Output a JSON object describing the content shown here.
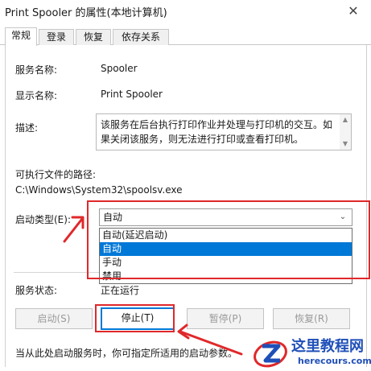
{
  "window": {
    "title": "Print Spooler 的属性(本地计算机)",
    "close_glyph": "✕"
  },
  "tabs": [
    {
      "label": "常规",
      "active": true
    },
    {
      "label": "登录",
      "active": false
    },
    {
      "label": "恢复",
      "active": false
    },
    {
      "label": "依存关系",
      "active": false
    }
  ],
  "general": {
    "service_name_label": "服务名称:",
    "service_name_value": "Spooler",
    "display_name_label": "显示名称:",
    "display_name_value": "Print Spooler",
    "description_label": "描述:",
    "description_text": "该服务在后台执行打印作业并处理与打印机的交互。如果关闭该服务，则无法进行打印或查看打印机。",
    "exec_path_label": "可执行文件的路径:",
    "exec_path_value": "C:\\Windows\\System32\\spoolsv.exe",
    "startup_type_label": "启动类型(E):",
    "startup_type_value": "自动",
    "startup_options": [
      {
        "label": "自动(延迟启动)",
        "selected": false
      },
      {
        "label": "自动",
        "selected": true
      },
      {
        "label": "手动",
        "selected": false
      },
      {
        "label": "禁用",
        "selected": false
      }
    ],
    "status_label": "服务状态:",
    "status_value": "正在运行",
    "buttons": {
      "start": "启动(S)",
      "stop": "停止(T)",
      "pause": "暂停(P)",
      "resume": "恢复(R)"
    },
    "hint_text": "当从此处启动服务时，你可指定所适用的启动参数。"
  },
  "annotation_color": "#e0282a",
  "accent_color": "#0078d7",
  "watermark": {
    "title": "这里教程网",
    "site": "herecours.com"
  }
}
